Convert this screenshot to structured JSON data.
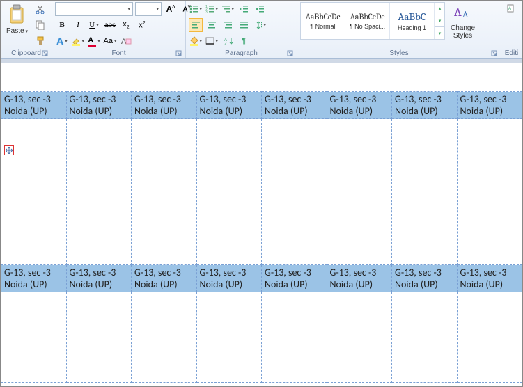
{
  "ribbon": {
    "clipboard": {
      "label": "Clipboard",
      "paste": "Paste"
    },
    "font": {
      "label": "Font",
      "bold": "B",
      "italic": "I",
      "underline": "U",
      "strike": "abc",
      "sub": "x",
      "sup": "x"
    },
    "paragraph": {
      "label": "Paragraph"
    },
    "styles": {
      "label": "Styles",
      "items": [
        {
          "sample": "AaBbCcDc",
          "name": "¶ Normal"
        },
        {
          "sample": "AaBbCcDc",
          "name": "¶ No Spaci..."
        },
        {
          "sample": "AaBbC",
          "name": "Heading 1"
        }
      ],
      "change": "Change\nStyles"
    },
    "editing": {
      "label": "Editi"
    }
  },
  "table": {
    "cell": {
      "line1": "G-13, sec -3",
      "line2": "Noida (UP)"
    },
    "cols": 8,
    "dataRows": 2
  }
}
